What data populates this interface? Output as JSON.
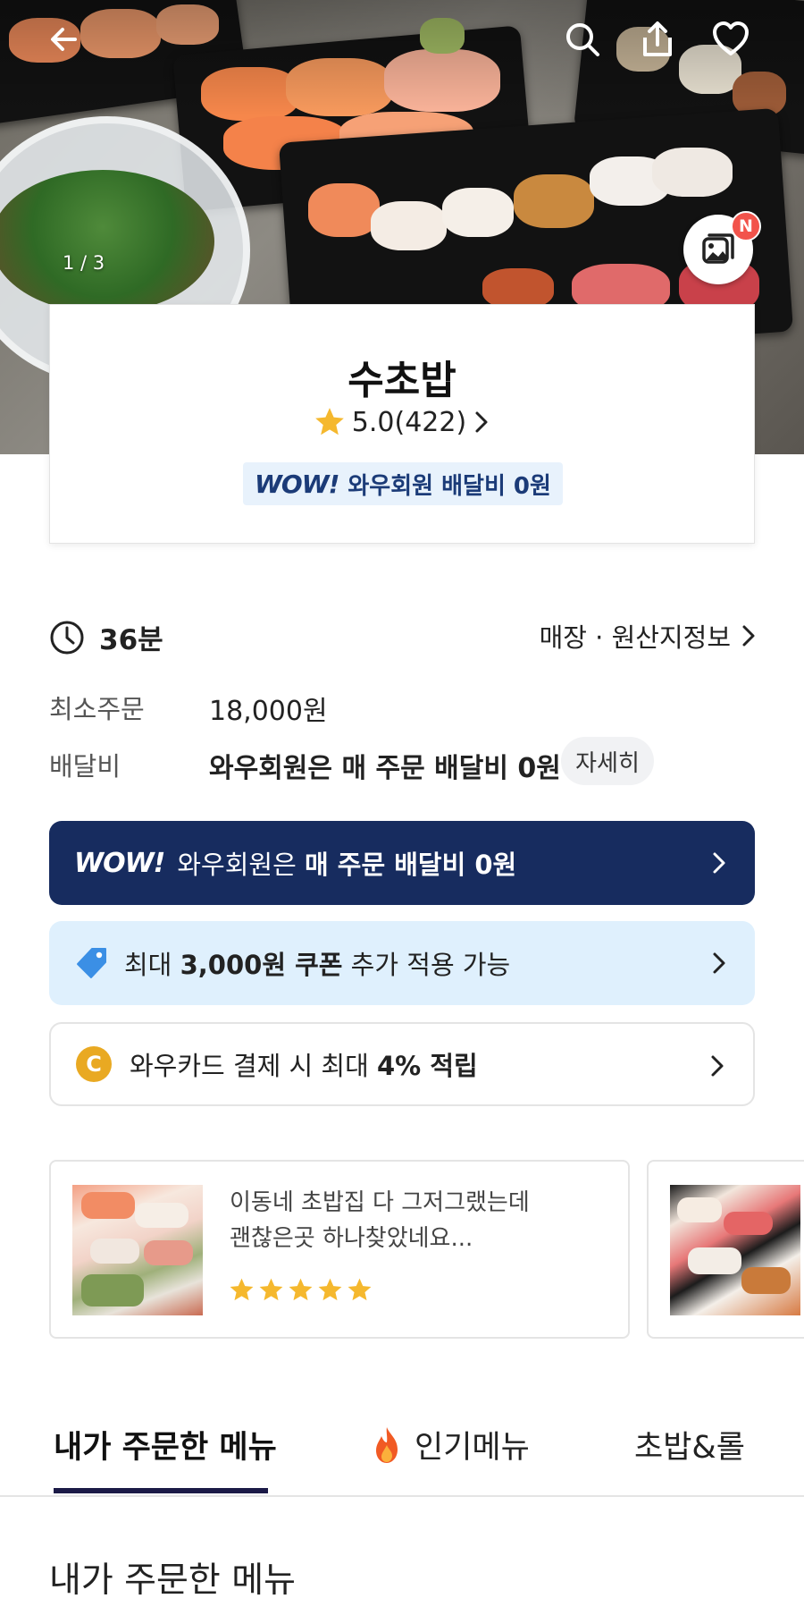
{
  "hero": {
    "counter": "1 / 3",
    "photo_badge": "N"
  },
  "store": {
    "name": "수초밥",
    "rating": "5.0",
    "review_count": "(422)",
    "wow_logo": "WOW!",
    "wow_text": "와우회원 배달비 0원"
  },
  "info": {
    "delivery_time": "36분",
    "origin_link": "매장 · 원산지정보",
    "min_order_label": "최소주문",
    "min_order_value": "18,000원",
    "delivery_fee_label": "배달비",
    "delivery_fee_value": "와우회원은 매 주문 배달비 0원",
    "detail_button": "자세히"
  },
  "banners": {
    "wow": {
      "logo": "WOW!",
      "text_plain": "와우회원은 ",
      "text_bold": "매 주문 배달비 0원"
    },
    "coupon": {
      "pre": "최대 ",
      "bold": "3,000원 쿠폰",
      "post": " 추가 적용 가능"
    },
    "card": {
      "coin": "C",
      "pre": "와우카드 결제 시 최대 ",
      "bold": "4% 적립"
    }
  },
  "reviews": [
    {
      "text": "이동네 초밥집 다 그저그랬는데 괜찮은곳 하나찾았네요...",
      "stars": 5
    }
  ],
  "tabs": [
    {
      "label": "내가 주문한 메뉴",
      "active": true
    },
    {
      "label": "인기메뉴",
      "icon": "fire-icon",
      "active": false
    },
    {
      "label": "초밥&롤",
      "active": false
    }
  ],
  "section": {
    "title": "내가 주문한 메뉴"
  },
  "colors": {
    "wow_navy": "#172c5f",
    "coupon_bg": "#dff0fd",
    "star": "#f5b82e",
    "badge_red": "#f2534b",
    "coin": "#e9a922",
    "tab_underline": "#1b1a47"
  }
}
